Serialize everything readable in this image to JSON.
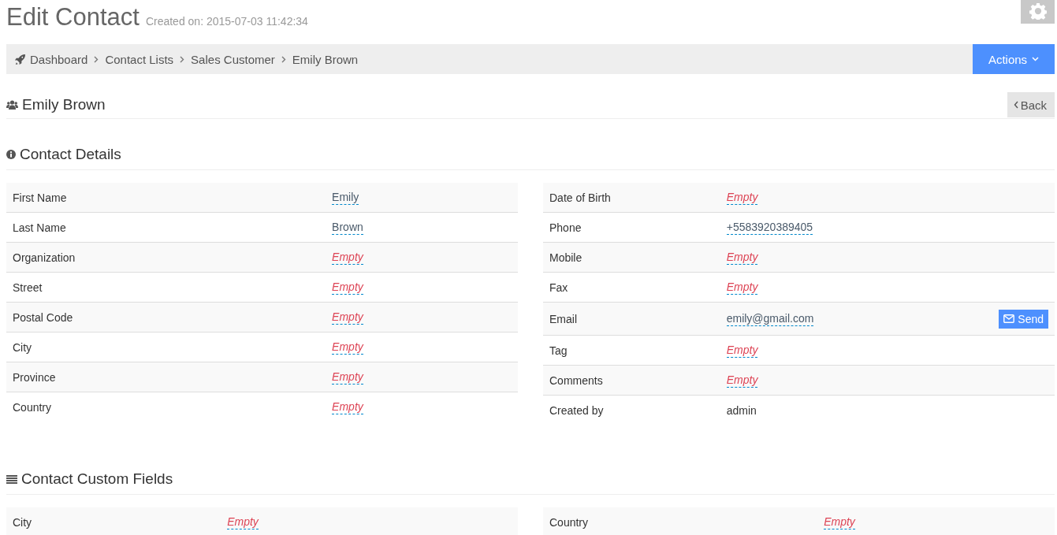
{
  "page": {
    "title": "Edit Contact",
    "subtitle": "Created on: 2015-07-03 11:42:34"
  },
  "breadcrumb": [
    {
      "label": "Dashboard"
    },
    {
      "label": "Contact Lists"
    },
    {
      "label": "Sales Customer"
    },
    {
      "label": "Emily Brown"
    }
  ],
  "actions_button": "Actions",
  "contact_header": {
    "name": "Emily Brown",
    "back_button": "Back"
  },
  "sections": [
    {
      "title": "Contact Details",
      "kind": "details",
      "tables": [
        [
          {
            "label": "First Name",
            "value": "Emily",
            "kind": "value"
          },
          {
            "label": "Last Name",
            "value": "Brown",
            "kind": "value"
          },
          {
            "label": "Organization",
            "value": "Empty",
            "kind": "empty"
          },
          {
            "label": "Street",
            "value": "Empty",
            "kind": "empty"
          },
          {
            "label": "Postal Code",
            "value": "Empty",
            "kind": "empty"
          },
          {
            "label": "City",
            "value": "Empty",
            "kind": "empty"
          },
          {
            "label": "Province",
            "value": "Empty",
            "kind": "empty"
          },
          {
            "label": "Country",
            "value": "Empty",
            "kind": "empty"
          }
        ],
        [
          {
            "label": "Date of Birth",
            "value": "Empty",
            "kind": "empty"
          },
          {
            "label": "Phone",
            "value": "+5583920389405",
            "kind": "value"
          },
          {
            "label": "Mobile",
            "value": "Empty",
            "kind": "empty"
          },
          {
            "label": "Fax",
            "value": "Empty",
            "kind": "empty"
          },
          {
            "label": "Email",
            "value": "emily@gmail.com",
            "kind": "value",
            "action": "Send"
          },
          {
            "label": "Tag",
            "value": "Empty",
            "kind": "empty"
          },
          {
            "label": "Comments",
            "value": "Empty",
            "kind": "empty"
          },
          {
            "label": "Created by",
            "value": "admin",
            "kind": "plain"
          }
        ]
      ]
    },
    {
      "title": "Contact Custom Fields",
      "kind": "custom",
      "tables": [
        [
          {
            "label": "City",
            "value": "Empty",
            "kind": "empty"
          }
        ],
        [
          {
            "label": "Country",
            "value": "Empty",
            "kind": "empty"
          }
        ]
      ]
    }
  ]
}
